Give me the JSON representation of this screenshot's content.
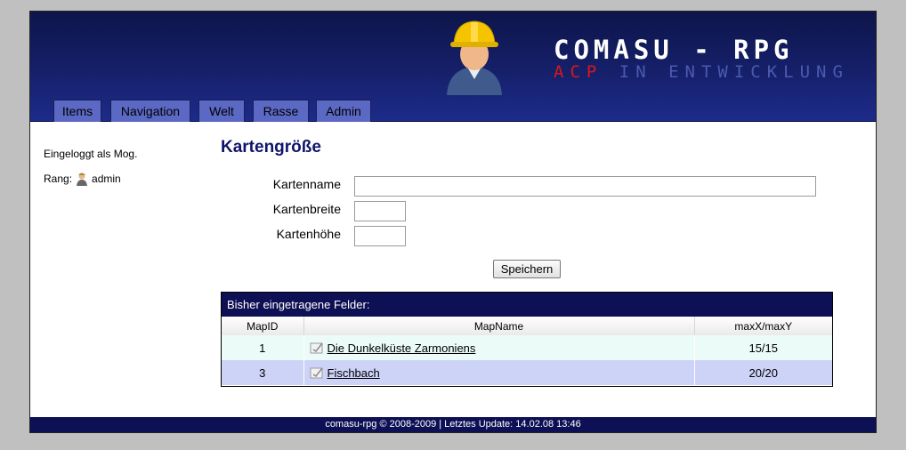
{
  "header": {
    "logo_title": "COMASU - RPG",
    "logo_acp": "ACP",
    "logo_dev": "IN ENTWICKLUNG"
  },
  "nav": {
    "tabs": [
      {
        "label": "Items"
      },
      {
        "label": "Navigation"
      },
      {
        "label": "Welt"
      },
      {
        "label": "Rasse"
      },
      {
        "label": "Admin"
      }
    ]
  },
  "sidebar": {
    "login_text": "Eingeloggt als Mog.",
    "rank_label": "Rang:",
    "rank_value": "admin"
  },
  "main": {
    "title": "Kartengröße",
    "form": {
      "name_label": "Kartenname",
      "name_value": "",
      "width_label": "Kartenbreite",
      "width_value": "",
      "height_label": "Kartenhöhe",
      "height_value": "",
      "save_label": "Speichern"
    },
    "table": {
      "caption": "Bisher eingetragene Felder:",
      "headers": [
        "MapID",
        "MapName",
        "maxX/maxY"
      ],
      "rows": [
        {
          "id": "1",
          "name": "Die Dunkelküste Zarmoniens",
          "max": "15/15"
        },
        {
          "id": "3",
          "name": "Fischbach",
          "max": "20/20"
        }
      ]
    }
  },
  "footer": {
    "text": "comasu-rpg © 2008-2009 | Letztes Update: 14.02.08 13:46"
  },
  "colors": {
    "header_bg": "#16206a",
    "tab_bg": "#5b68c4",
    "title": "#10156a",
    "row_a": "#ebfbf8",
    "row_b": "#cdd2f7"
  }
}
